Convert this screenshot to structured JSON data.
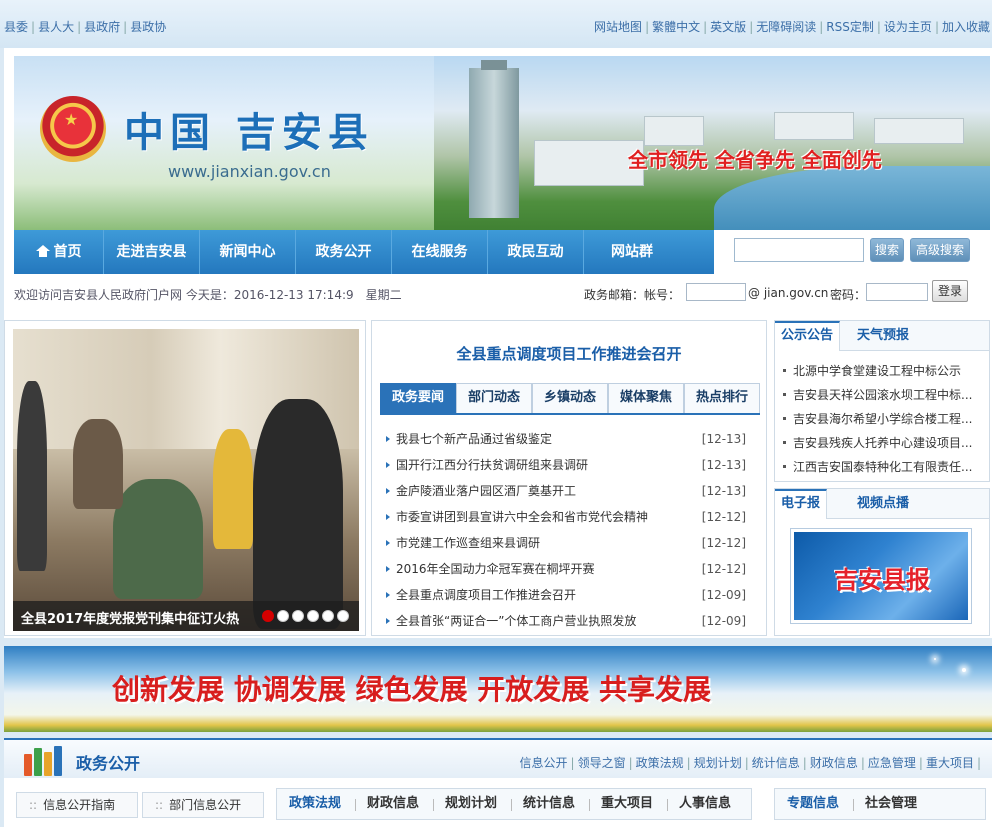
{
  "top_bar": {
    "left_links": [
      "县委",
      "县人大",
      "县政府",
      "县政协"
    ],
    "right_links": [
      "网站地图",
      "繁體中文",
      "英文版",
      "无障碍阅读",
      "RSS定制",
      "设为主页",
      "加入收藏"
    ]
  },
  "header": {
    "emblem_glyph": "★",
    "title": "中国 吉安县",
    "url": "www.jianxian.gov.cn",
    "slogan": "全市领先 全省争先 全面创先"
  },
  "nav": {
    "items": [
      "首页",
      "走进吉安县",
      "新闻中心",
      "政务公开",
      "在线服务",
      "政民互动",
      "网站群"
    ],
    "search_button": "搜索",
    "advanced_button": "高级搜索"
  },
  "welcome": {
    "text": "欢迎访问吉安县人民政府门户网 今天是：2016-12-13 17:14:9　星期二",
    "mail_label": "政务邮箱：帐号：",
    "mail_domain": "@ jian.gov.cn",
    "password_label": "密码：",
    "login_button": "登录"
  },
  "slideshow": {
    "caption": "全县2017年度党报党刊集中征订火热",
    "dots": 6,
    "active_dot": 1
  },
  "news": {
    "headline": "全县重点调度项目工作推进会召开",
    "tabs": [
      "政务要闻",
      "部门动态",
      "乡镇动态",
      "媒体聚焦",
      "热点排行"
    ],
    "active_tab": 0,
    "items": [
      {
        "title": "我县七个新产品通过省级鉴定",
        "date": "[12-13]"
      },
      {
        "title": "国开行江西分行扶贫调研组来县调研",
        "date": "[12-13]"
      },
      {
        "title": "金庐陵酒业落户园区酒厂奠基开工",
        "date": "[12-13]"
      },
      {
        "title": "市委宣讲团到县宣讲六中全会和省市党代会精神",
        "date": "[12-12]"
      },
      {
        "title": "市党建工作巡查组来县调研",
        "date": "[12-12]"
      },
      {
        "title": "2016年全国动力伞冠军赛在桐坪开赛",
        "date": "[12-12]"
      },
      {
        "title": "全县重点调度项目工作推进会召开",
        "date": "[12-09]"
      },
      {
        "title": "全县首张“两证合一”个体工商户营业执照发放",
        "date": "[12-09]"
      }
    ]
  },
  "notice": {
    "tabs": [
      "公示公告",
      "天气预报"
    ],
    "items": [
      "北源中学食堂建设工程中标公示",
      "吉安县天祥公园滚水坝工程中标...",
      "吉安县海尔希望小学综合楼工程...",
      "吉安县残疾人托养中心建设项目...",
      "江西吉安国泰特种化工有限责任..."
    ]
  },
  "epaper": {
    "tabs": [
      "电子报",
      "视频点播"
    ],
    "title": "吉安县报"
  },
  "big_banner": {
    "text": "创新发展 协调发展 绿色发展 开放发展 共享发展"
  },
  "gov_section": {
    "title": "政务公开",
    "links": [
      "信息公开",
      "领导之窗",
      "政策法规",
      "规划计划",
      "统计信息",
      "财政信息",
      "应急管理",
      "重大项目"
    ],
    "guides": [
      "信息公开指南",
      "部门信息公开"
    ],
    "tabs": [
      "政策法规",
      "财政信息",
      "规划计划",
      "统计信息",
      "重大项目",
      "人事信息"
    ],
    "right_tabs": [
      "专题信息",
      "社会管理"
    ]
  },
  "colors": {
    "primary_blue": "#2a72b8",
    "nav_blue": "#2f86cc",
    "accent_red": "#e02020"
  }
}
